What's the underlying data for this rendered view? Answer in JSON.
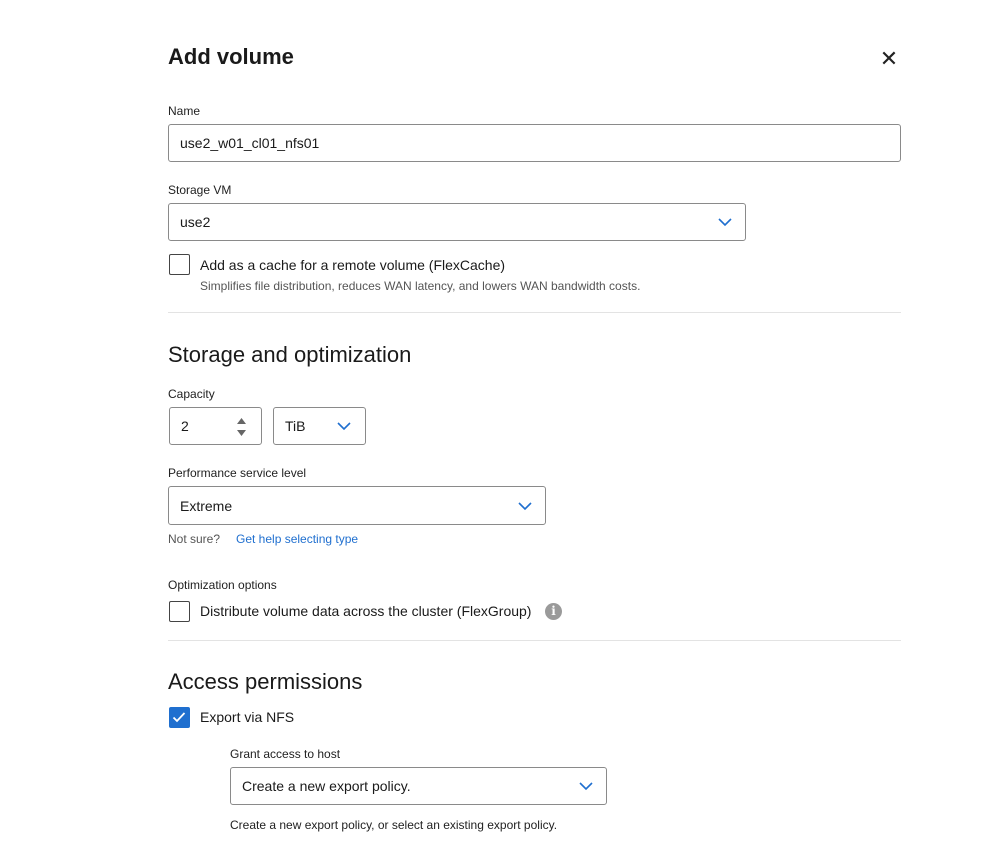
{
  "dialog": {
    "title": "Add volume",
    "close_icon": "close-icon",
    "close_glyph": "✕"
  },
  "name": {
    "label": "Name",
    "value": "use2_w01_cl01_nfs01"
  },
  "storage_vm": {
    "label": "Storage VM",
    "value": "use2"
  },
  "flexcache": {
    "label": "Add as a cache for a remote volume (FlexCache)",
    "hint": "Simplifies file distribution, reduces WAN latency, and lowers WAN bandwidth costs.",
    "checked": false
  },
  "storage_section": {
    "title": "Storage and optimization"
  },
  "capacity": {
    "label": "Capacity",
    "value": "2",
    "unit": "TiB"
  },
  "performance": {
    "label": "Performance service level",
    "value": "Extreme",
    "not_sure": "Not sure?",
    "help_link": "Get help selecting type"
  },
  "optimization": {
    "label": "Optimization options",
    "flexgroup_label": "Distribute volume data across the cluster (FlexGroup)",
    "checked": false,
    "info_glyph": "i"
  },
  "access_section": {
    "title": "Access permissions"
  },
  "nfs": {
    "label": "Export via NFS",
    "checked": true
  },
  "grant": {
    "label": "Grant access to host",
    "value": "Create a new export policy.",
    "hint": "Create a new export policy, or select an existing export policy."
  },
  "colors": {
    "accent": "#1f6fcf",
    "border": "#8a8a8a",
    "divider": "#e3e3e3"
  }
}
